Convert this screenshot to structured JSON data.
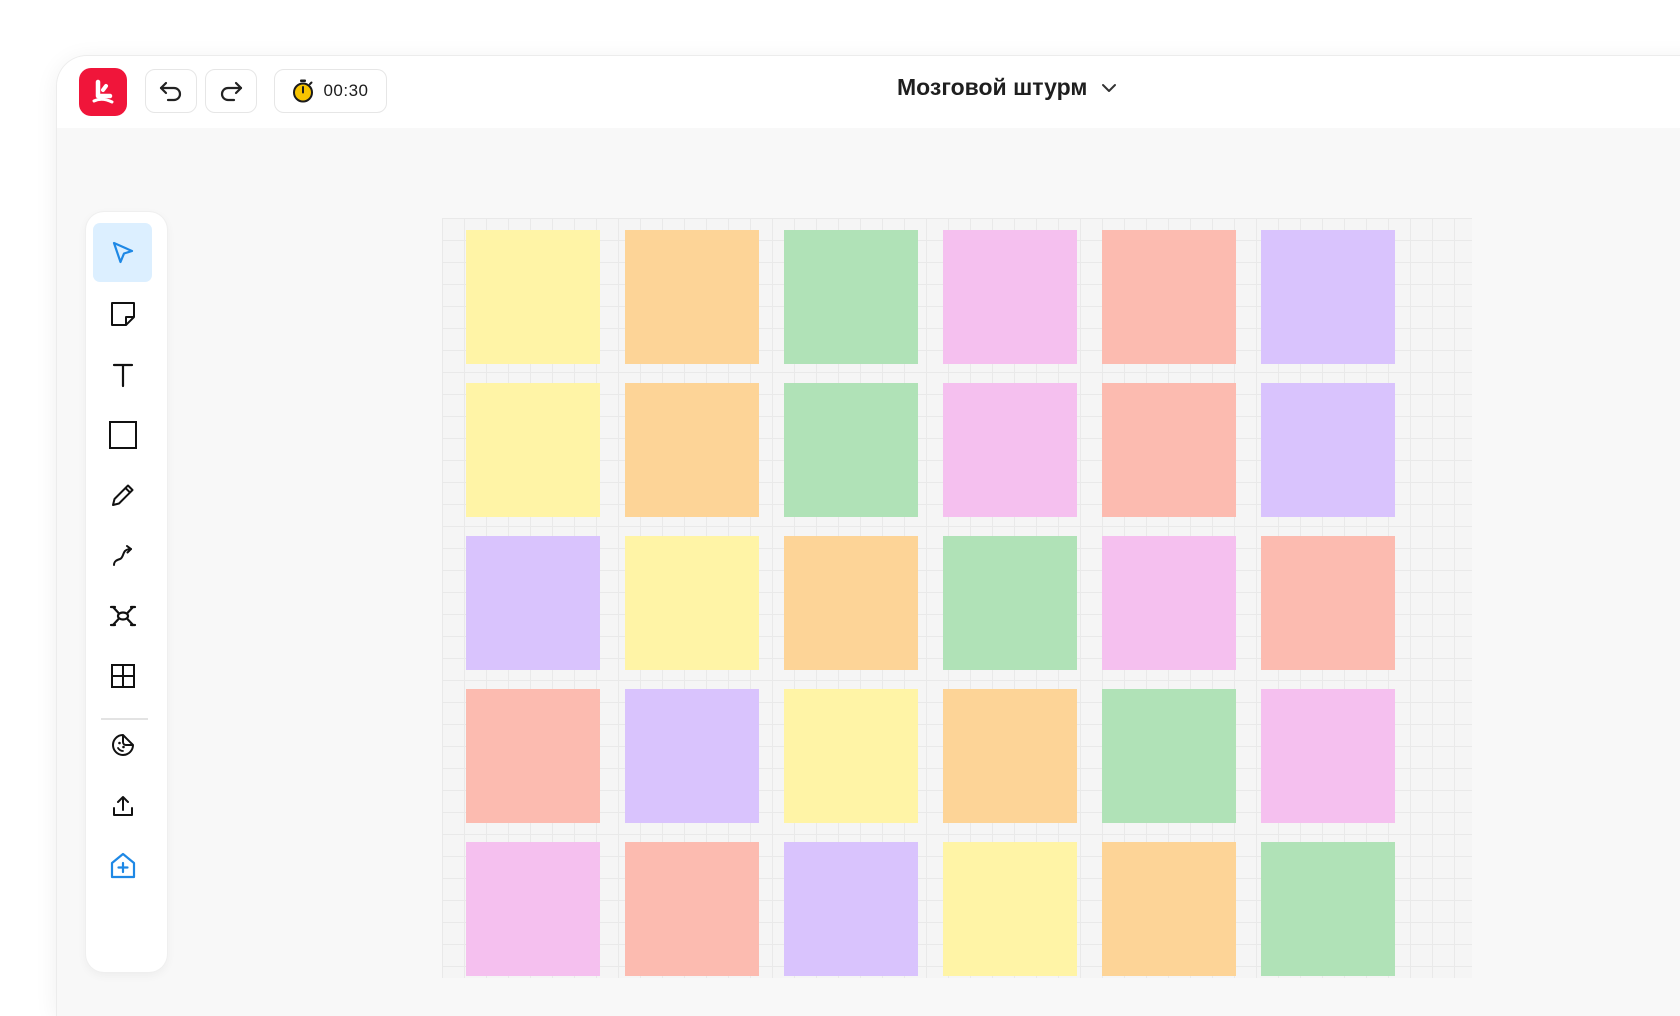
{
  "app": {
    "board_title": "Мозговой штурм",
    "brand_color": "#f0153a",
    "accent_color": "#1e88e5"
  },
  "toolbar_top": {
    "timer": {
      "text": "00:30",
      "icon": "stopwatch-icon"
    },
    "undo_icon": "undo-icon",
    "redo_icon": "redo-icon",
    "title_dropdown_icon": "chevron-down-icon"
  },
  "tools": [
    {
      "id": "select",
      "icon": "cursor-arrow-icon",
      "active": true
    },
    {
      "id": "sticky-note",
      "icon": "sticky-note-icon",
      "active": false
    },
    {
      "id": "text",
      "icon": "text-icon",
      "active": false
    },
    {
      "id": "rectangle",
      "icon": "rectangle-icon",
      "active": false
    },
    {
      "id": "pen",
      "icon": "pencil-icon",
      "active": false
    },
    {
      "id": "connector",
      "icon": "connector-arrow-icon",
      "active": false
    },
    {
      "id": "mindmap",
      "icon": "mindmap-icon",
      "active": false
    },
    {
      "id": "table",
      "icon": "table-grid-icon",
      "active": false
    },
    {
      "id": "stickers",
      "icon": "sticker-icon",
      "active": false
    },
    {
      "id": "upload",
      "icon": "upload-icon",
      "active": false
    },
    {
      "id": "templates",
      "icon": "add-frame-icon",
      "active": false
    }
  ],
  "note_colors": {
    "yellow": "#fff4a6",
    "orange": "#fdd497",
    "green": "#b0e2b7",
    "pink": "#f5c0ef",
    "salmon": "#fcbbb0",
    "purple": "#d9c3fd"
  },
  "sticky_grid": [
    [
      "yellow",
      "orange",
      "green",
      "pink",
      "salmon",
      "purple"
    ],
    [
      "yellow",
      "orange",
      "green",
      "pink",
      "salmon",
      "purple"
    ],
    [
      "purple",
      "yellow",
      "orange",
      "green",
      "pink",
      "salmon"
    ],
    [
      "salmon",
      "purple",
      "yellow",
      "orange",
      "green",
      "pink"
    ],
    [
      "pink",
      "salmon",
      "purple",
      "yellow",
      "orange",
      "green"
    ]
  ]
}
